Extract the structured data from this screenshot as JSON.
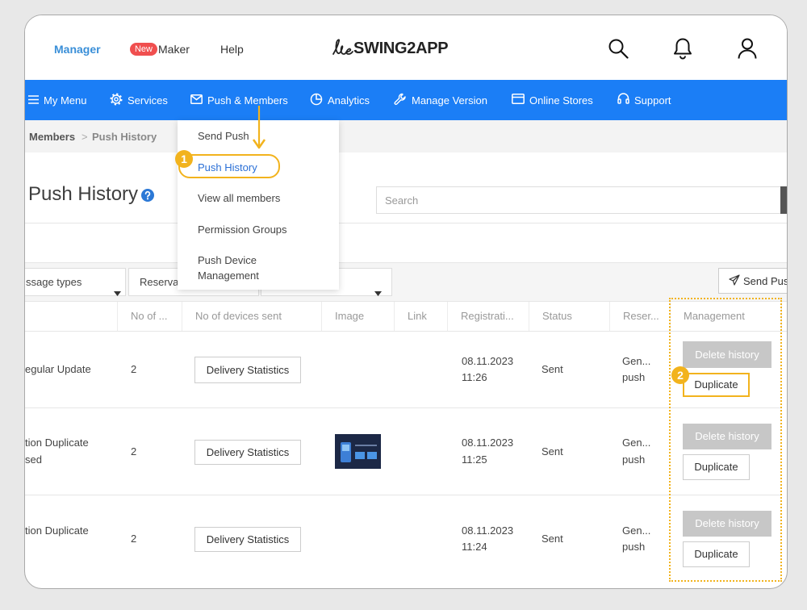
{
  "header": {
    "manager_label": "Manager",
    "new_badge": "New",
    "maker_label": "Maker",
    "help_label": "Help",
    "logo_text": "SWING2APP",
    "icons": {
      "search": "search-icon",
      "notifications": "bell-icon",
      "account": "user-icon"
    }
  },
  "nav": {
    "items": [
      {
        "label": "My Menu",
        "icon": "menu-icon"
      },
      {
        "label": "Services",
        "icon": "gear-icon"
      },
      {
        "label": "Push & Members",
        "icon": "envelope-icon"
      },
      {
        "label": "Analytics",
        "icon": "pie-chart-icon"
      },
      {
        "label": "Manage Version",
        "icon": "wrench-icon"
      },
      {
        "label": "Online Stores",
        "icon": "card-icon"
      },
      {
        "label": "Support",
        "icon": "headset-icon"
      }
    ]
  },
  "dropdown": {
    "items": [
      {
        "label": "Send Push"
      },
      {
        "label": "Push History",
        "active": true
      },
      {
        "label": "View all members"
      },
      {
        "label": "Permission Groups"
      },
      {
        "label": "Push Device Management"
      }
    ]
  },
  "breadcrumb": {
    "parent": "Members",
    "separator": ">",
    "current": "Push History"
  },
  "page": {
    "title": "Push History",
    "help_icon": "question-circle-icon",
    "search_placeholder": "Search"
  },
  "filters": {
    "message_types": "ssage types",
    "reservation": "Reserva",
    "send_push_label": "Send Push"
  },
  "table": {
    "headers": [
      "No of ...",
      "No of devices sent",
      "Image",
      "Link",
      "Registrati...",
      "Status",
      "Reser...",
      "Management"
    ],
    "rows": [
      {
        "title_lines": [
          "egular Update"
        ],
        "count": "2",
        "delivery_label": "Delivery Statistics",
        "has_image": false,
        "date": "08.11.2023",
        "time": "11:26",
        "status": "Sent",
        "reservation_lines": [
          "Gen...",
          "push"
        ],
        "delete_label": "Delete history",
        "duplicate_label": "Duplicate"
      },
      {
        "title_lines": [
          "tion Duplicate",
          "sed"
        ],
        "count": "2",
        "delivery_label": "Delivery Statistics",
        "has_image": true,
        "date": "08.11.2023",
        "time": "11:25",
        "status": "Sent",
        "reservation_lines": [
          "Gen...",
          "push"
        ],
        "delete_label": "Delete history",
        "duplicate_label": "Duplicate"
      },
      {
        "title_lines": [
          "tion Duplicate"
        ],
        "count": "2",
        "delivery_label": "Delivery Statistics",
        "has_image": false,
        "date": "08.11.2023",
        "time": "11:24",
        "status": "Sent",
        "reservation_lines": [
          "Gen...",
          "push"
        ],
        "delete_label": "Delete history",
        "duplicate_label": "Duplicate"
      }
    ]
  },
  "annotations": {
    "step1": "1",
    "step2": "2"
  },
  "colors": {
    "nav_blue": "#1b7ef6",
    "manager_blue": "#3a8fd8",
    "new_badge_red": "#f04f4f",
    "active_item_blue": "#2a6fd6",
    "annotation_orange": "#f2b31d",
    "delete_button_gray": "#c7c7c7"
  }
}
